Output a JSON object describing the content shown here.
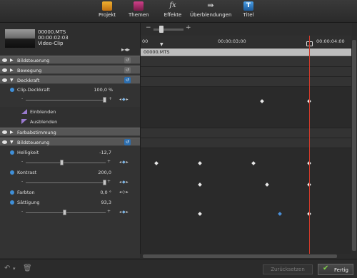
{
  "toolbar": {
    "items": [
      {
        "label": "Projekt",
        "icon": "projekt-icon",
        "color": "#e8a020"
      },
      {
        "label": "Themen",
        "icon": "themen-icon",
        "color": "#b03070"
      },
      {
        "label": "Effekte",
        "icon": "effekte-icon",
        "color": "#cfcfcf"
      },
      {
        "label": "Überblendungen",
        "icon": "ueberblendungen-icon",
        "color": "#cfcfcf"
      },
      {
        "label": "Titel",
        "icon": "titel-icon",
        "color": "#3a8fd6"
      }
    ]
  },
  "clip": {
    "name": "00000.MTS",
    "duration": "00:00:02:03",
    "type": "Video-Clip"
  },
  "timeline": {
    "ruler_start": "00",
    "ruler_mid": "00:00:03:00",
    "ruler_end": "00:00:04:00",
    "clip_lane_label": "00000.MTS"
  },
  "effects": {
    "bildsteuerung_top": "Bildsteuerung",
    "bewegung": "Bewegung",
    "deckkraft": "Deckkraft",
    "clip_deckkraft_label": "Clip-Deckkraft",
    "clip_deckkraft_value": "100,0",
    "clip_deckkraft_unit": "%",
    "einblenden": "Einblenden",
    "ausblenden": "Ausblenden",
    "farbabstimmung": "Farbabstimmung",
    "bildsteuerung": "Bildsteuerung",
    "helligkeit_label": "Helligkeit",
    "helligkeit_value": "-12,7",
    "kontrast_label": "Kontrast",
    "kontrast_value": "200,0",
    "farbton_label": "Farbton",
    "farbton_value": "0,0 °",
    "saettigung_label": "Sättigung",
    "saettigung_value": "93,3"
  },
  "bottom": {
    "reset_label": "Zurücksetzen",
    "done_label": "Fertig"
  },
  "colors": {
    "playhead": "#d23a2a",
    "accent_blue": "#3f8fd8",
    "done_check": "#7fd04a"
  }
}
